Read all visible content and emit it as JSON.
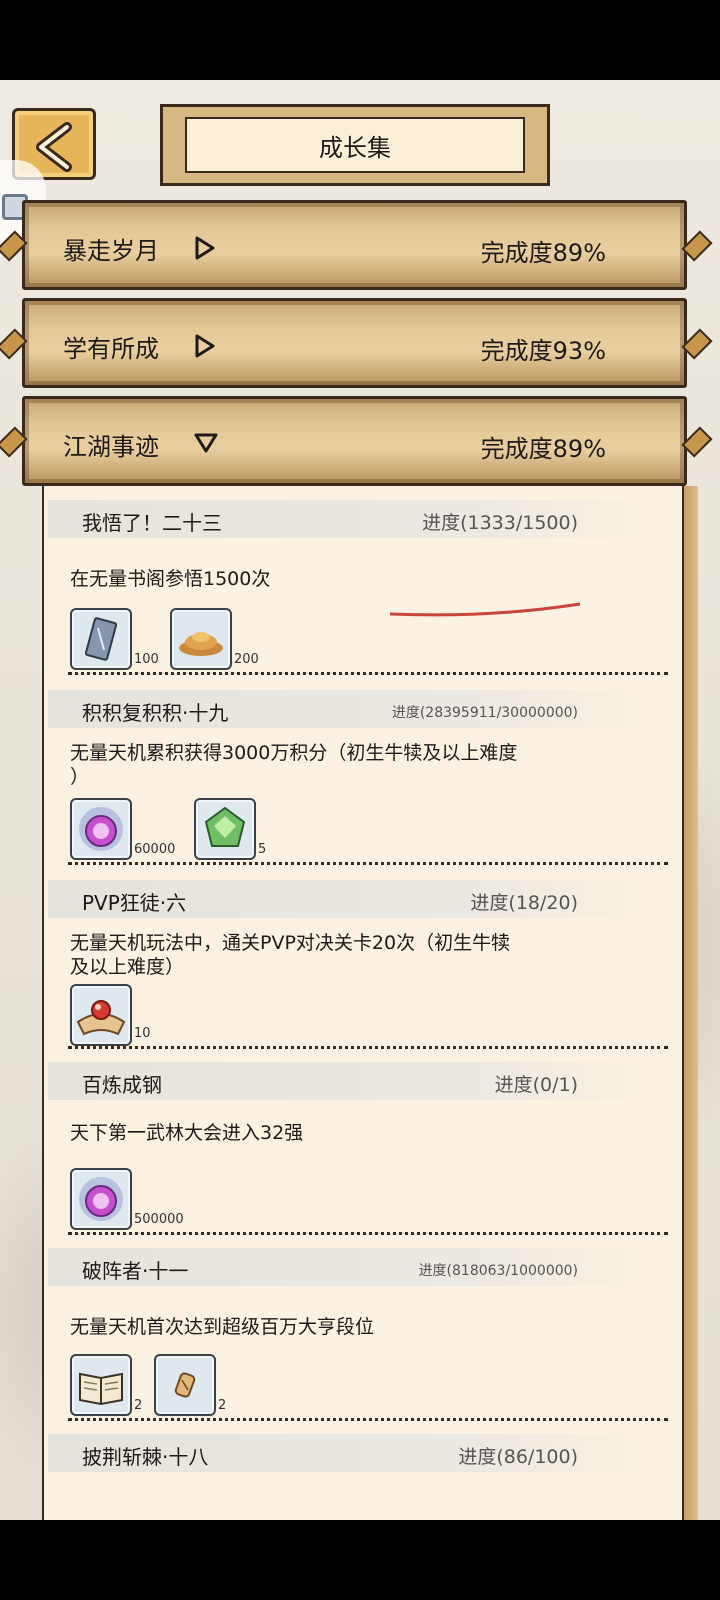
{
  "header": {
    "title": "成长集"
  },
  "categories": [
    {
      "name": "暴走岁月",
      "progress": "完成度89%",
      "expanded": false
    },
    {
      "name": "学有所成",
      "progress": "完成度93%",
      "expanded": false
    },
    {
      "name": "江湖事迹",
      "progress": "完成度89%",
      "expanded": true
    }
  ],
  "tasks": [
    {
      "name": "我悟了！二十三",
      "progress": "进度(1333/1500)",
      "desc": "在无量书阁参悟1500次",
      "rewards": [
        {
          "icon": "talisman-icon",
          "count": "100"
        },
        {
          "icon": "coin-pile-icon",
          "count": "200"
        }
      ]
    },
    {
      "name": "积积复积积·十九",
      "progress": "进度(28395911/30000000)",
      "desc": "无量天机累积获得3000万积分（初生牛犊及以上难度",
      "desc2": "）",
      "rewards": [
        {
          "icon": "purple-orb-icon",
          "count": "60000"
        },
        {
          "icon": "jade-gem-icon",
          "count": "5"
        }
      ]
    },
    {
      "name": "PVP狂徒·六",
      "progress": "进度(18/20)",
      "desc": "无量天机玩法中，通关PVP对决关卡20次（初生牛犊",
      "desc2": "及以上难度）",
      "rewards": [
        {
          "icon": "red-pearl-scroll-icon",
          "count": "10"
        }
      ]
    },
    {
      "name": "百炼成钢",
      "progress": "进度(0/1)",
      "desc": "天下第一武林大会进入32强",
      "rewards": [
        {
          "icon": "purple-orb-icon",
          "count": "500000"
        }
      ]
    },
    {
      "name": "破阵者·十一",
      "progress": "进度(818063/1000000)",
      "desc": "无量天机首次达到超级百万大亨段位",
      "rewards": [
        {
          "icon": "book-icon",
          "count": "2"
        },
        {
          "icon": "scroll-icon",
          "count": "2"
        }
      ]
    },
    {
      "name": "披荆斩棘·十八",
      "progress": "进度(86/100)"
    }
  ]
}
